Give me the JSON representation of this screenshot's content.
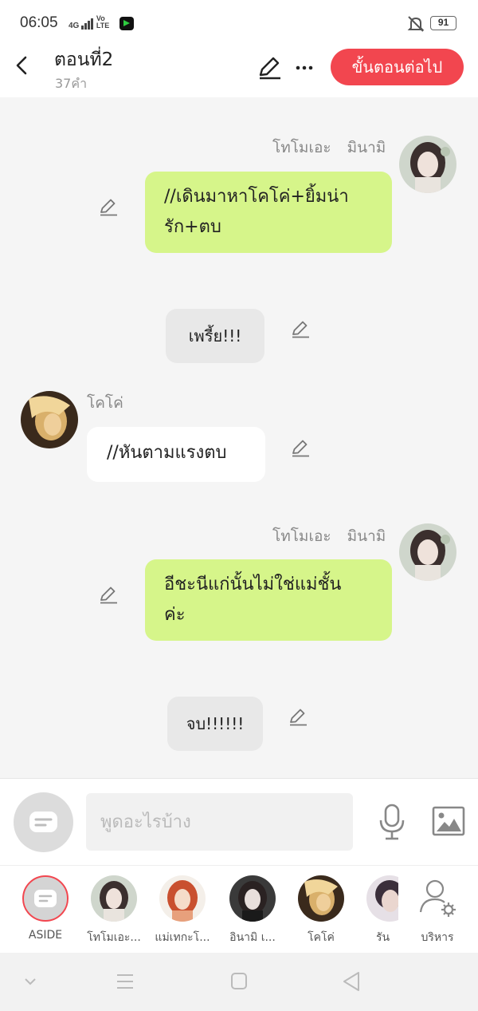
{
  "status_bar": {
    "time": "06:05",
    "network_top": "4G",
    "network_bottom": "Vo LTE",
    "battery": "91"
  },
  "header": {
    "title": "ตอนที่2",
    "word_count": "37คำ",
    "next_button": "ขั้นตอนต่อไป"
  },
  "messages": [
    {
      "speaker": "โทโมเอะ มินามิ",
      "text": "//เดินมาหาโคโค่+ยิ้มน่ารัก+ตบ",
      "line1": "//เดินมาหาโคโค่+ยิ้มน่า",
      "line2": "รัก+ตบ",
      "side": "right"
    },
    {
      "speaker": "",
      "text": "เพรี้ย!!!",
      "side": "narration"
    },
    {
      "speaker": "โคโค่",
      "text": "//หันตามแรงตบ",
      "side": "left"
    },
    {
      "speaker": "โทโมเอะ มินามิ",
      "text": "อีชะนีแก่นั้นไม่ใช่แม่ชั้นค่ะ",
      "line1": "อีชะนีแก่นั้นไม่ใช่แม่ชั้น",
      "line2": "ค่ะ",
      "side": "right"
    },
    {
      "speaker": "",
      "text": "จบ!!!!!!",
      "side": "narration"
    }
  ],
  "speaker_names": {
    "tomoe_1": "โทโมเอะ",
    "tomoe_2": "มินามิ"
  },
  "input": {
    "placeholder": "พูดอะไรบ้าง"
  },
  "characters": [
    {
      "label": "ASIDE"
    },
    {
      "label": "โทโมเอะ..."
    },
    {
      "label": "แม่เทกะโ..."
    },
    {
      "label": "อินามิ  เ..."
    },
    {
      "label": "โคโค่"
    },
    {
      "label": "รัน"
    },
    {
      "label": "บริหาร"
    }
  ],
  "colors": {
    "accent": "#f2464f",
    "bubble_green": "#d6f58a",
    "background": "#f5f5f5"
  }
}
